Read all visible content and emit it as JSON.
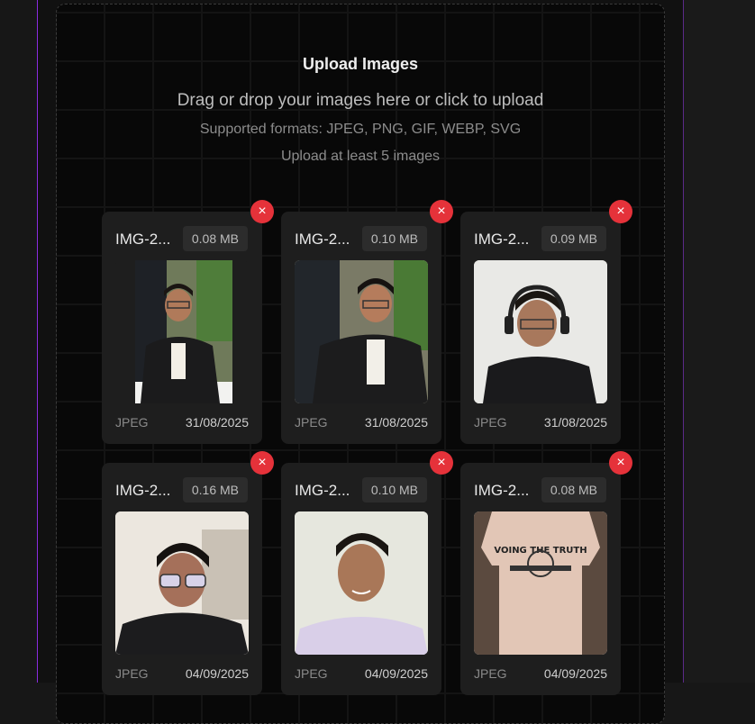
{
  "upload": {
    "title": "Upload Images",
    "subtitle": "Drag or drop your images here or click to upload",
    "formats": "Supported formats: JPEG, PNG, GIF, WEBP, SVG",
    "minimum": "Upload at least 5 images"
  },
  "remove_icon": "×",
  "images": [
    {
      "name": "IMG-2...",
      "size": "0.08 MB",
      "type": "JPEG",
      "date": "31/08/2025"
    },
    {
      "name": "IMG-2...",
      "size": "0.10 MB",
      "type": "JPEG",
      "date": "31/08/2025"
    },
    {
      "name": "IMG-2...",
      "size": "0.09 MB",
      "type": "JPEG",
      "date": "31/08/2025"
    },
    {
      "name": "IMG-2...",
      "size": "0.16 MB",
      "type": "JPEG",
      "date": "04/09/2025"
    },
    {
      "name": "IMG-2...",
      "size": "0.10 MB",
      "type": "JPEG",
      "date": "04/09/2025"
    },
    {
      "name": "IMG-2...",
      "size": "0.08 MB",
      "type": "JPEG",
      "date": "04/09/2025"
    }
  ],
  "shirt_print": "VOING THE TRUTH",
  "colors": {
    "remove": "#e5323a",
    "accent_border": "#8a2be2"
  }
}
